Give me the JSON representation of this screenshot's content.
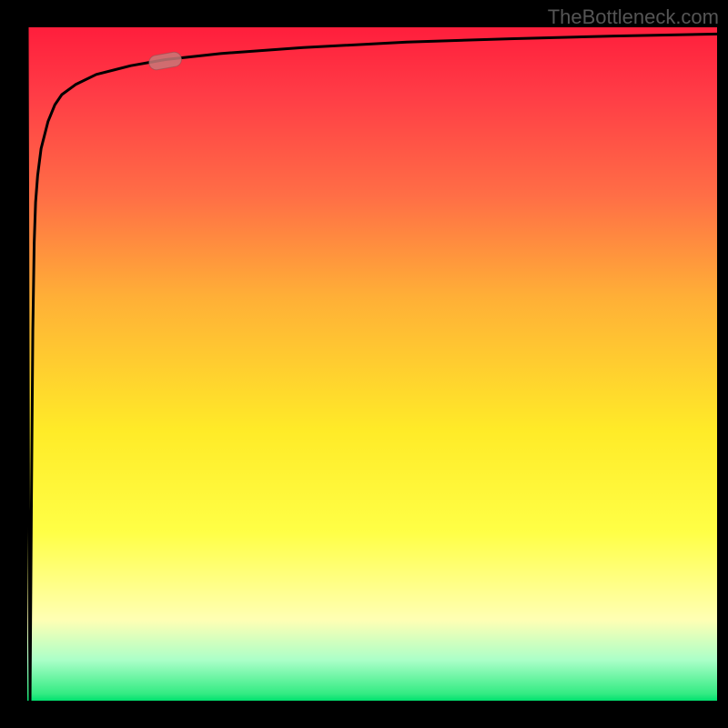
{
  "watermark": "TheBottleneck.com",
  "colors": {
    "gradient_top": "#ff1e3c",
    "gradient_mid_orange": "#ffae37",
    "gradient_mid_yellow": "#ffff46",
    "gradient_light": "#ffffd0",
    "gradient_green": "#22e47f",
    "curve_stroke": "#000000",
    "marker_fill": "#c87878",
    "background": "#000000",
    "watermark_text": "#555555"
  },
  "chart_data": {
    "type": "line",
    "title": "",
    "xlabel": "",
    "ylabel": "",
    "xlim": [
      0,
      100
    ],
    "ylim": [
      0,
      100
    ],
    "grid": false,
    "legend": false,
    "series": [
      {
        "name": "bottleneck-curve",
        "x": [
          0,
          0.2,
          0.4,
          0.6,
          0.8,
          1.0,
          1.2,
          1.5,
          2,
          3,
          4,
          5,
          7,
          10,
          15,
          20,
          28,
          40,
          55,
          70,
          85,
          100
        ],
        "y": [
          100,
          25,
          0,
          30,
          55,
          68,
          74,
          78,
          82,
          86,
          88.5,
          90,
          91.5,
          93,
          94.3,
          95.2,
          96.1,
          97,
          97.8,
          98.3,
          98.7,
          99
        ]
      }
    ],
    "marker": {
      "x": 20,
      "y": 95,
      "shape": "rounded-pill"
    },
    "background_gradient": {
      "direction": "top-to-bottom",
      "stops": [
        {
          "pos": 0.0,
          "color": "#ff1e3c"
        },
        {
          "pos": 0.1,
          "color": "#ff3c46"
        },
        {
          "pos": 0.25,
          "color": "#ff6e46"
        },
        {
          "pos": 0.4,
          "color": "#ffae37"
        },
        {
          "pos": 0.6,
          "color": "#ffeb28"
        },
        {
          "pos": 0.75,
          "color": "#ffff46"
        },
        {
          "pos": 0.88,
          "color": "#ffffb4"
        },
        {
          "pos": 0.94,
          "color": "#aaffc8"
        },
        {
          "pos": 0.99,
          "color": "#32eb82"
        },
        {
          "pos": 1.0,
          "color": "#00e16e"
        }
      ]
    }
  }
}
